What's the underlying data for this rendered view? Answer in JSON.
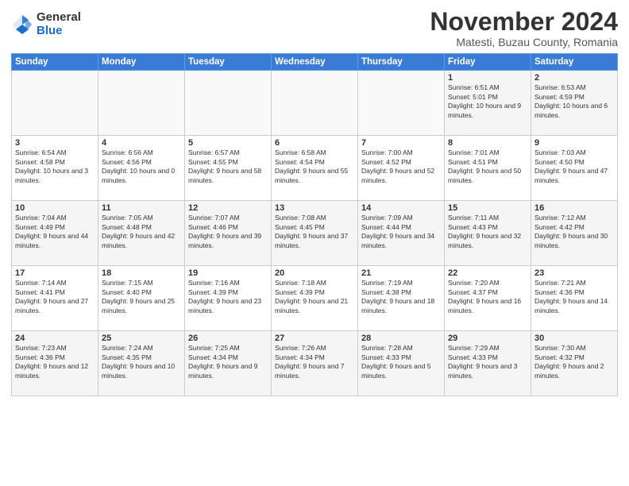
{
  "header": {
    "logo_general": "General",
    "logo_blue": "Blue",
    "month_title": "November 2024",
    "subtitle": "Matesti, Buzau County, Romania"
  },
  "weekdays": [
    "Sunday",
    "Monday",
    "Tuesday",
    "Wednesday",
    "Thursday",
    "Friday",
    "Saturday"
  ],
  "weeks": [
    [
      {
        "day": "",
        "info": ""
      },
      {
        "day": "",
        "info": ""
      },
      {
        "day": "",
        "info": ""
      },
      {
        "day": "",
        "info": ""
      },
      {
        "day": "",
        "info": ""
      },
      {
        "day": "1",
        "info": "Sunrise: 6:51 AM\nSunset: 5:01 PM\nDaylight: 10 hours and 9 minutes."
      },
      {
        "day": "2",
        "info": "Sunrise: 6:53 AM\nSunset: 4:59 PM\nDaylight: 10 hours and 6 minutes."
      }
    ],
    [
      {
        "day": "3",
        "info": "Sunrise: 6:54 AM\nSunset: 4:58 PM\nDaylight: 10 hours and 3 minutes."
      },
      {
        "day": "4",
        "info": "Sunrise: 6:56 AM\nSunset: 4:56 PM\nDaylight: 10 hours and 0 minutes."
      },
      {
        "day": "5",
        "info": "Sunrise: 6:57 AM\nSunset: 4:55 PM\nDaylight: 9 hours and 58 minutes."
      },
      {
        "day": "6",
        "info": "Sunrise: 6:58 AM\nSunset: 4:54 PM\nDaylight: 9 hours and 55 minutes."
      },
      {
        "day": "7",
        "info": "Sunrise: 7:00 AM\nSunset: 4:52 PM\nDaylight: 9 hours and 52 minutes."
      },
      {
        "day": "8",
        "info": "Sunrise: 7:01 AM\nSunset: 4:51 PM\nDaylight: 9 hours and 50 minutes."
      },
      {
        "day": "9",
        "info": "Sunrise: 7:03 AM\nSunset: 4:50 PM\nDaylight: 9 hours and 47 minutes."
      }
    ],
    [
      {
        "day": "10",
        "info": "Sunrise: 7:04 AM\nSunset: 4:49 PM\nDaylight: 9 hours and 44 minutes."
      },
      {
        "day": "11",
        "info": "Sunrise: 7:05 AM\nSunset: 4:48 PM\nDaylight: 9 hours and 42 minutes."
      },
      {
        "day": "12",
        "info": "Sunrise: 7:07 AM\nSunset: 4:46 PM\nDaylight: 9 hours and 39 minutes."
      },
      {
        "day": "13",
        "info": "Sunrise: 7:08 AM\nSunset: 4:45 PM\nDaylight: 9 hours and 37 minutes."
      },
      {
        "day": "14",
        "info": "Sunrise: 7:09 AM\nSunset: 4:44 PM\nDaylight: 9 hours and 34 minutes."
      },
      {
        "day": "15",
        "info": "Sunrise: 7:11 AM\nSunset: 4:43 PM\nDaylight: 9 hours and 32 minutes."
      },
      {
        "day": "16",
        "info": "Sunrise: 7:12 AM\nSunset: 4:42 PM\nDaylight: 9 hours and 30 minutes."
      }
    ],
    [
      {
        "day": "17",
        "info": "Sunrise: 7:14 AM\nSunset: 4:41 PM\nDaylight: 9 hours and 27 minutes."
      },
      {
        "day": "18",
        "info": "Sunrise: 7:15 AM\nSunset: 4:40 PM\nDaylight: 9 hours and 25 minutes."
      },
      {
        "day": "19",
        "info": "Sunrise: 7:16 AM\nSunset: 4:39 PM\nDaylight: 9 hours and 23 minutes."
      },
      {
        "day": "20",
        "info": "Sunrise: 7:18 AM\nSunset: 4:39 PM\nDaylight: 9 hours and 21 minutes."
      },
      {
        "day": "21",
        "info": "Sunrise: 7:19 AM\nSunset: 4:38 PM\nDaylight: 9 hours and 18 minutes."
      },
      {
        "day": "22",
        "info": "Sunrise: 7:20 AM\nSunset: 4:37 PM\nDaylight: 9 hours and 16 minutes."
      },
      {
        "day": "23",
        "info": "Sunrise: 7:21 AM\nSunset: 4:36 PM\nDaylight: 9 hours and 14 minutes."
      }
    ],
    [
      {
        "day": "24",
        "info": "Sunrise: 7:23 AM\nSunset: 4:36 PM\nDaylight: 9 hours and 12 minutes."
      },
      {
        "day": "25",
        "info": "Sunrise: 7:24 AM\nSunset: 4:35 PM\nDaylight: 9 hours and 10 minutes."
      },
      {
        "day": "26",
        "info": "Sunrise: 7:25 AM\nSunset: 4:34 PM\nDaylight: 9 hours and 9 minutes."
      },
      {
        "day": "27",
        "info": "Sunrise: 7:26 AM\nSunset: 4:34 PM\nDaylight: 9 hours and 7 minutes."
      },
      {
        "day": "28",
        "info": "Sunrise: 7:28 AM\nSunset: 4:33 PM\nDaylight: 9 hours and 5 minutes."
      },
      {
        "day": "29",
        "info": "Sunrise: 7:29 AM\nSunset: 4:33 PM\nDaylight: 9 hours and 3 minutes."
      },
      {
        "day": "30",
        "info": "Sunrise: 7:30 AM\nSunset: 4:32 PM\nDaylight: 9 hours and 2 minutes."
      }
    ]
  ]
}
